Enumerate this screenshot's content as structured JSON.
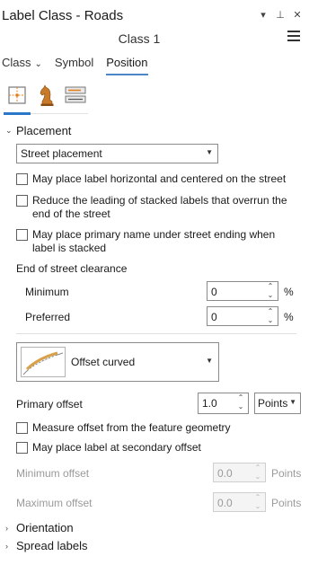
{
  "window": {
    "title": "Label Class - Roads",
    "controls": [
      "▾",
      "⊥",
      "✕"
    ]
  },
  "class_name": "Class 1",
  "tabs": [
    {
      "label": "Class",
      "has_menu": true
    },
    {
      "label": "Symbol"
    },
    {
      "label": "Position",
      "active": true
    }
  ],
  "icon_tabs": [
    "placement-icon",
    "conflict-resolution-icon",
    "fitting-strategy-icon"
  ],
  "placement": {
    "header": "Placement",
    "expanded": true,
    "dropdown_value": "Street placement",
    "checkboxes": [
      {
        "label": "May place label horizontal and centered on the street",
        "checked": false
      },
      {
        "label": "Reduce the leading of stacked labels that overrun the end of the street",
        "checked": false
      },
      {
        "label": "May place primary name under street ending when label is stacked",
        "checked": false
      }
    ],
    "clearance_title": "End of street clearance",
    "minimum_label": "Minimum",
    "minimum_value": "0",
    "preferred_label": "Preferred",
    "preferred_value": "0",
    "percent_unit": "%"
  },
  "offset": {
    "shape_name": "Offset curved",
    "primary_offset_label": "Primary offset",
    "primary_offset_value": "1.0",
    "units_value": "Points",
    "measure_checkbox": "Measure offset from the feature geometry",
    "secondary_checkbox": "May place label at secondary offset",
    "min_offset_label": "Minimum offset",
    "min_offset_value": "0.0",
    "max_offset_label": "Maximum offset",
    "max_offset_value": "0.0",
    "points_unit": "Points"
  },
  "sections": [
    {
      "label": "Orientation",
      "expanded": false
    },
    {
      "label": "Spread labels",
      "expanded": false
    }
  ]
}
